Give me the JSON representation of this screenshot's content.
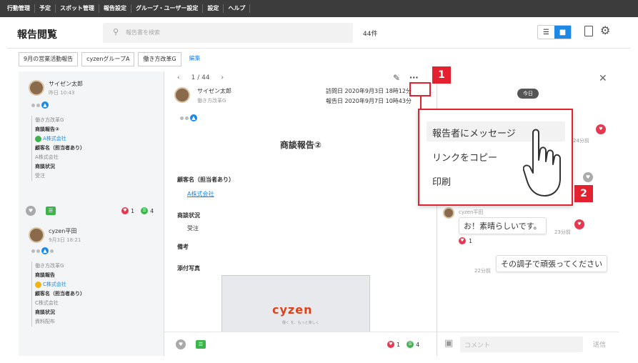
{
  "nav": [
    "行動管理",
    "予定",
    "スポット管理",
    "報告設定",
    "グループ・ユーザー設定",
    "設定",
    "ヘルプ"
  ],
  "header": {
    "title": "報告閲覧",
    "search_placeholder": "報告書を検索",
    "count": "44件"
  },
  "filters": [
    "9月の営業活動報告",
    "cyzenグループA",
    "働き方改革G",
    "編集"
  ],
  "cards": [
    {
      "name": "サイゼン太郎",
      "time": "昨日 10:43",
      "group": "働き方改革G",
      "report": "商談報告②",
      "company": "A株式会社",
      "f1": "顧客名（担当者あり）",
      "v1": "A株式会社",
      "f2": "商談状況",
      "v2": "受注",
      "likes": "1",
      "comments": "4",
      "pin_color": "#3cb44b"
    },
    {
      "name": "cyzen平田",
      "time": "9月3日 18:21",
      "group": "働き方改革G",
      "report": "商談報告",
      "company": "C株式会社",
      "f1": "顧客名（担当者あり）",
      "v1": "C株式会社",
      "f2": "商談状況",
      "v2": "資料配布",
      "pin_color": "#f2b20f"
    }
  ],
  "detail": {
    "pager": "1 / 44",
    "author": "サイゼン太郎",
    "group": "働き方改革G",
    "visit": "訪問日  2020年9月3日 18時12分",
    "reported": "報告日  2020年9月7日 10時43分",
    "title": "商談報告②",
    "sec1": "顧客名（担当者あり）",
    "sec1_link": "A株式会社",
    "sec2": "商談状況",
    "sec2_val": "受注",
    "sec3": "備考",
    "sec4": "添付写真",
    "photo_logo": "cyzen",
    "photo_caption": "働く を、もっと楽しく",
    "likes": "1",
    "comments": "4"
  },
  "chat": {
    "today": "今日",
    "t1": "24分前",
    "user": "cyzen平田",
    "msg1": "お！素晴らしいです。",
    "t2": "23分前",
    "like": "1",
    "msg2": "その調子で頑張ってください",
    "t3": "22分前",
    "placeholder": "コメント",
    "send": "送信"
  },
  "menu": {
    "items": [
      "報告者にメッセージ",
      "リンクをコピー",
      "印刷"
    ]
  },
  "callouts": [
    "1",
    "2"
  ],
  "colors": {
    "accent": "#1e88e5",
    "highlight": "#e4212f"
  }
}
